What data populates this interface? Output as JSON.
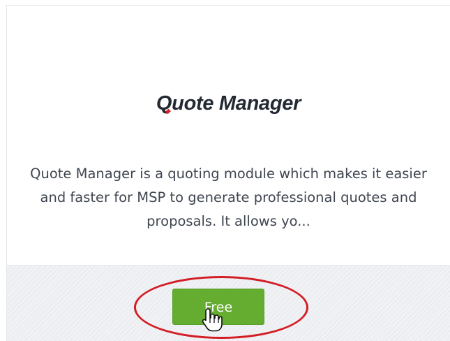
{
  "card": {
    "title": "Quote Manager",
    "title_first_letter": "Q",
    "title_rest": "uote Manager",
    "description": "Quote Manager is a quoting module which makes it easier and faster for MSP to generate professional quotes and proposals. It allows yo...",
    "button_label": "Free"
  },
  "colors": {
    "button": "#64ad30",
    "highlight": "#d31d25",
    "title": "#232a33",
    "logo_accent": "#d6242f"
  },
  "icons": {
    "cursor": "hand-pointer-icon"
  }
}
